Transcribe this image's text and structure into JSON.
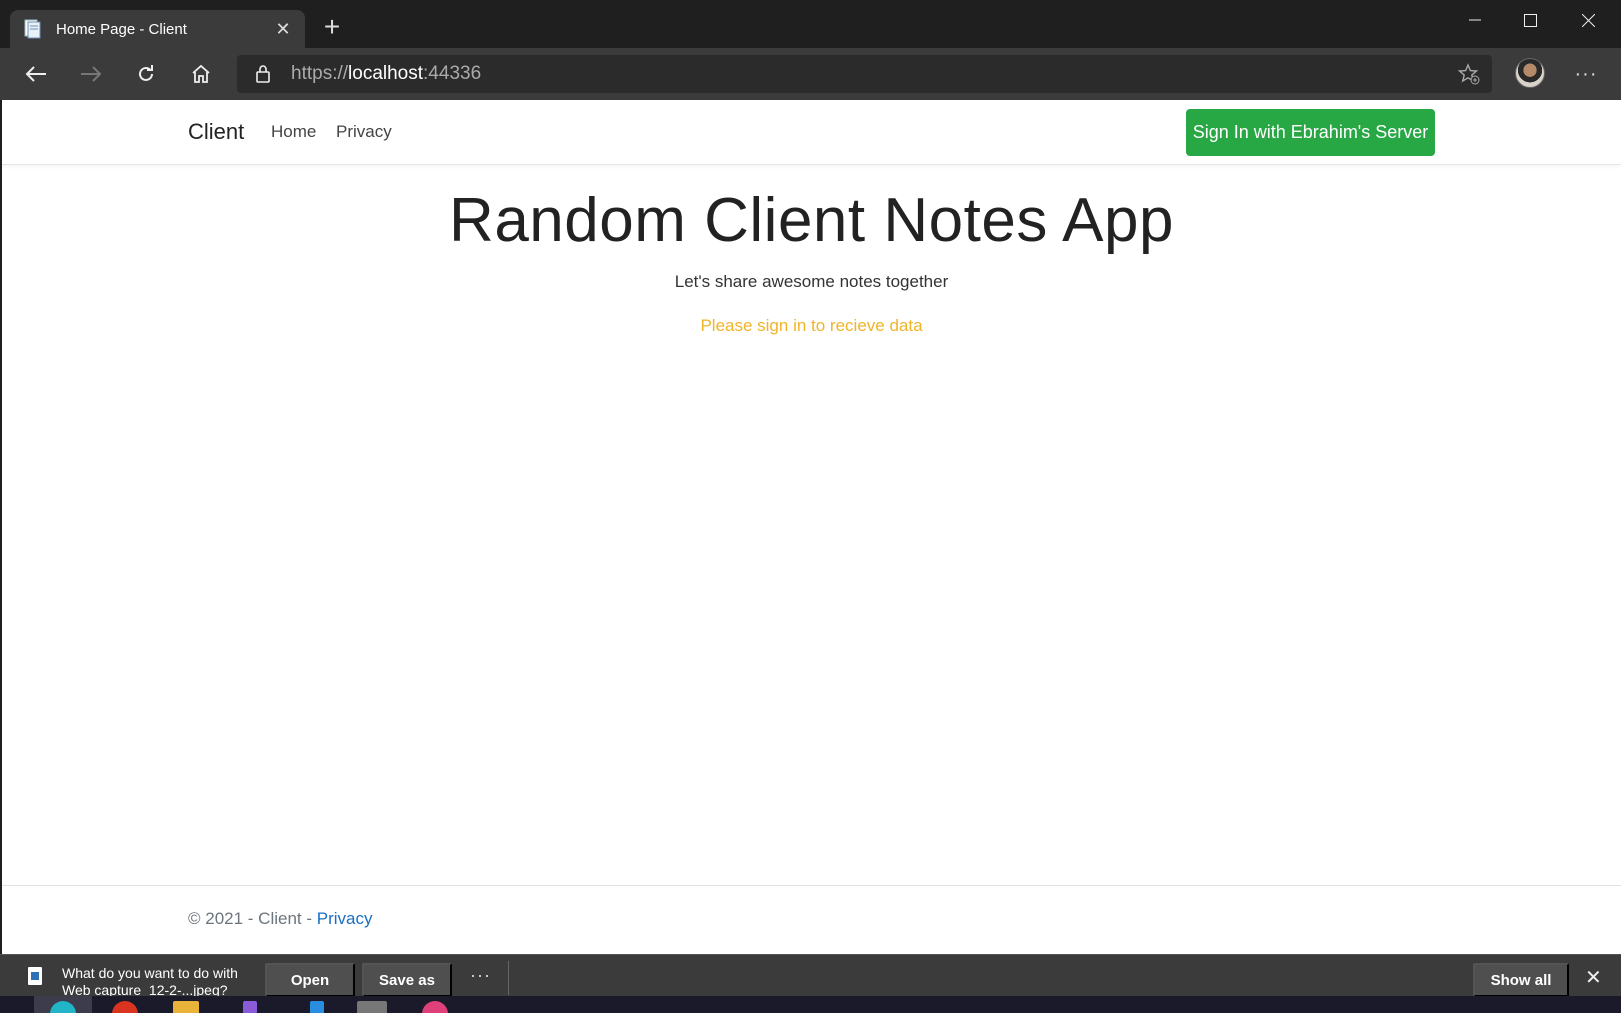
{
  "browser": {
    "tab_title": "Home Page - Client",
    "tab_close_glyph": "✕",
    "new_tab_glyph": "+",
    "url_scheme": "https://",
    "url_host": "localhost",
    "url_port": ":44336",
    "more_glyph": "···",
    "window": {
      "minimize": "—",
      "maximize": "☐",
      "close": "✕"
    }
  },
  "navbar": {
    "brand": "Client",
    "links": [
      "Home",
      "Privacy"
    ],
    "signin_label": "Sign In with Ebrahim's Server",
    "signin_color": "#28a745"
  },
  "hero": {
    "title": "Random Client Notes App",
    "subtitle": "Let's share awesome notes together",
    "warning": "Please sign in to recieve data",
    "warning_color": "#f0b429"
  },
  "footer": {
    "copyright": "© 2021 - Client - ",
    "privacy_link": "Privacy",
    "link_color": "#1b6ec2"
  },
  "download_bar": {
    "prompt": "What do you want to do with Web capture_12-2-...jpeg?",
    "open_label": "Open",
    "save_as_label": "Save as",
    "more_glyph": "···",
    "show_all_label": "Show all",
    "close_glyph": "✕"
  },
  "icons": [
    "page-favicon-icon",
    "back-icon",
    "forward-icon",
    "refresh-icon",
    "home-icon",
    "lock-icon",
    "favorites-star-icon",
    "profile-avatar",
    "more-icon",
    "file-icon"
  ]
}
